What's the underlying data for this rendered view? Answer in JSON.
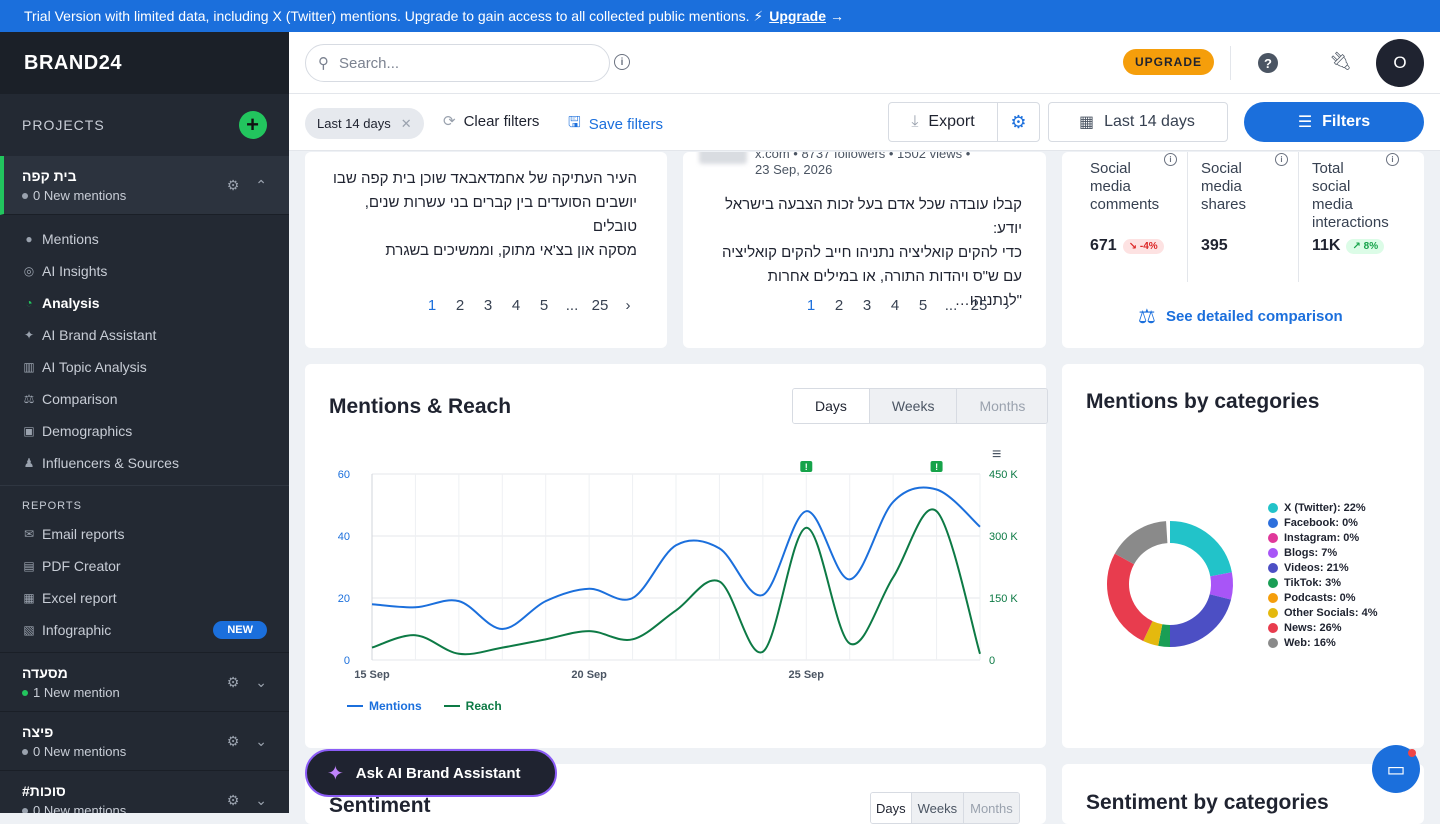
{
  "banner": {
    "text": "Trial Version with limited data, including X (Twitter) mentions. Upgrade to gain access to all collected public mentions. ⚡",
    "link": "Upgrade",
    "arrow": "→"
  },
  "sidebar": {
    "logo": "BRAND24",
    "projects_label": "PROJECTS",
    "add_icon": "+",
    "active_project": {
      "name": "בית קפה",
      "sub": "0 New mentions"
    },
    "nav": [
      {
        "label": "Mentions",
        "icon": "●"
      },
      {
        "label": "AI Insights",
        "icon": "◎"
      },
      {
        "label": "Analysis",
        "icon": "◔"
      },
      {
        "label": "AI Brand Assistant",
        "icon": "✦"
      },
      {
        "label": "AI Topic Analysis",
        "icon": "▥"
      },
      {
        "label": "Comparison",
        "icon": "⚖"
      },
      {
        "label": "Demographics",
        "icon": "▣"
      },
      {
        "label": "Influencers & Sources",
        "icon": "♟"
      }
    ],
    "reports_label": "REPORTS",
    "reports": [
      {
        "label": "Email reports",
        "icon": "✉"
      },
      {
        "label": "PDF Creator",
        "icon": "▤"
      },
      {
        "label": "Excel report",
        "icon": "▦"
      },
      {
        "label": "Infographic",
        "icon": "▧"
      }
    ],
    "new_badge": "NEW",
    "other_projects": [
      {
        "name": "מסעדה",
        "sub": "1 New mention",
        "dot": "green"
      },
      {
        "name": "פיצה",
        "sub": "0 New mentions",
        "dot": "gray"
      },
      {
        "name": "#סוכות",
        "sub": "0 New mentions",
        "dot": "gray"
      }
    ]
  },
  "topbar": {
    "search_placeholder": "Search...",
    "upgrade": "UPGRADE",
    "help": "?",
    "avatar": "O"
  },
  "filterbar": {
    "chip": "Last 14 days",
    "chip_close": "✕",
    "clear": "Clear filters",
    "save": "Save filters",
    "export": "Export",
    "date": "Last 14 days",
    "filters": "Filters"
  },
  "posts": {
    "left": {
      "lines": [
        "העיר העתיקה של אחמדאבאד שוכן בית קפה שבו",
        "יושבים הסועדים בין קברים בני עשרות שנים, טובלים",
        "מסקה און בצ'אי מתוק, וממשיכים בשגרת"
      ],
      "pages": [
        "1",
        "2",
        "3",
        "4",
        "5",
        "...",
        "25"
      ]
    },
    "mid": {
      "meta": "x.com • 8737 followers • 1502 views •",
      "date": "23 Sep, 2026",
      "lines": [
        "קבלו עובדה שכל אדם בעל זכות הצבעה בישראל יודע:",
        "כדי להקים קואליציה נתניהו חייב להקים קואליציה",
        "עם ש\"ס ויהדות התורה, או במילים אחרות \"לנתניהו…"
      ],
      "pages": [
        "1",
        "2",
        "3",
        "4",
        "5",
        "...",
        "25"
      ]
    },
    "stats": {
      "cols": [
        {
          "label": [
            "Social",
            "media",
            "comments"
          ],
          "value": "671",
          "pill": "↘ -4%",
          "pill_type": "red"
        },
        {
          "label": [
            "Social",
            "media",
            "shares"
          ],
          "value": "395",
          "pill": "",
          "pill_type": ""
        },
        {
          "label": [
            "Total",
            "social",
            "media",
            "interactions"
          ],
          "value": "11K",
          "pill": "↗ 8%",
          "pill_type": "green"
        }
      ],
      "link": "See detailed comparison"
    }
  },
  "mentions_reach": {
    "title": "Mentions & Reach",
    "tabs": [
      "Days",
      "Weeks",
      "Months"
    ],
    "legend": [
      "Mentions",
      "Reach"
    ]
  },
  "categories": {
    "title": "Mentions by categories",
    "items": [
      {
        "label": "X (Twitter): 22%",
        "color": "#22c3c9"
      },
      {
        "label": "Facebook: 0%",
        "color": "#2d6fdc"
      },
      {
        "label": "Instagram: 0%",
        "color": "#e0389a"
      },
      {
        "label": "Blogs: 7%",
        "color": "#a855f7"
      },
      {
        "label": "Videos: 21%",
        "color": "#4c4fc4"
      },
      {
        "label": "TikTok: 3%",
        "color": "#1a9e55"
      },
      {
        "label": "Podcasts: 0%",
        "color": "#f59e0b"
      },
      {
        "label": "Other Socials: 4%",
        "color": "#e4b90e"
      },
      {
        "label": "News: 26%",
        "color": "#e83c4e"
      },
      {
        "label": "Web: 16%",
        "color": "#8a8a8a"
      }
    ]
  },
  "sentiment": {
    "title": "Sentiment",
    "tabs": [
      "Days",
      "Weeks",
      "Months"
    ],
    "cat_title": "Sentiment by categories"
  },
  "ai_button": "Ask AI Brand Assistant",
  "chart_data": {
    "type": "line",
    "title": "Mentions & Reach",
    "x": [
      "15 Sep",
      "16 Sep",
      "17 Sep",
      "18 Sep",
      "19 Sep",
      "20 Sep",
      "21 Sep",
      "22 Sep",
      "23 Sep",
      "24 Sep",
      "25 Sep",
      "26 Sep",
      "27 Sep",
      "28 Sep",
      "29 Sep"
    ],
    "x_tick_labels": [
      "15 Sep",
      "20 Sep",
      "25 Sep"
    ],
    "series": [
      {
        "name": "Mentions",
        "axis": "left",
        "color": "#1b6fdc",
        "values": [
          18,
          17,
          19,
          10,
          19,
          23,
          20,
          37,
          36,
          21,
          48,
          26,
          51,
          55,
          43
        ]
      },
      {
        "name": "Reach",
        "axis": "right",
        "color": "#0d7a45",
        "values": [
          30000,
          60000,
          15000,
          30000,
          50000,
          70000,
          50000,
          120000,
          190000,
          20000,
          320000,
          40000,
          200000,
          360000,
          15000
        ]
      }
    ],
    "ylim_left": [
      0,
      60
    ],
    "yticks_left": [
      "0",
      "20",
      "40",
      "60"
    ],
    "ylim_right": [
      0,
      450000
    ],
    "yticks_right": [
      "0",
      "150 K",
      "300 K",
      "450 K"
    ],
    "legend": "bottom-left",
    "grid": true
  }
}
